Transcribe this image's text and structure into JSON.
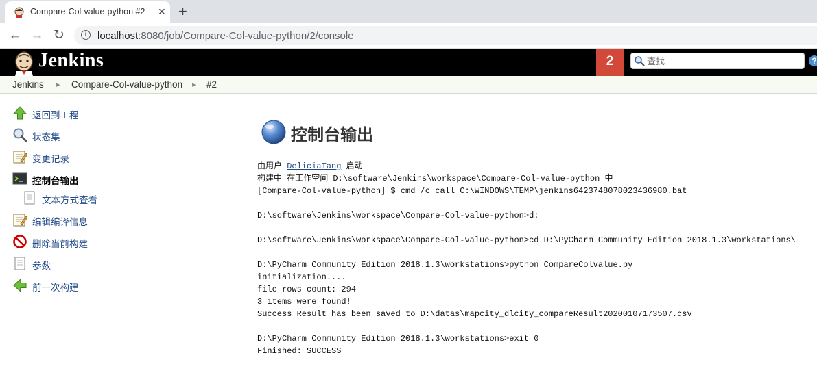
{
  "browser": {
    "tab_title": "Compare-Col-value-python #2",
    "close_glyph": "✕",
    "new_tab_glyph": "+",
    "back_glyph": "←",
    "forward_glyph": "→",
    "reload_glyph": "↻",
    "url_host": "localhost",
    "url_rest": ":8080/job/Compare-Col-value-python/2/console"
  },
  "header": {
    "title": "Jenkins",
    "badge": "2",
    "search_placeholder": "查找",
    "help": "?"
  },
  "breadcrumb": [
    "Jenkins",
    "Compare-Col-value-python",
    "#2"
  ],
  "breadcrumb_sep": "▸",
  "sidebar": {
    "items": [
      {
        "label": "返回到工程",
        "icon": "up-arrow-icon"
      },
      {
        "label": "状态集",
        "icon": "magnifier-icon"
      },
      {
        "label": "变更记录",
        "icon": "notepad-icon"
      },
      {
        "label": "控制台输出",
        "icon": "terminal-icon"
      },
      {
        "label": "文本方式查看",
        "icon": "document-icon"
      },
      {
        "label": "编辑编译信息",
        "icon": "notepad-icon"
      },
      {
        "label": "删除当前构建",
        "icon": "no-entry-icon"
      },
      {
        "label": "参数",
        "icon": "document-icon"
      },
      {
        "label": "前一次构建",
        "icon": "left-arrow-icon"
      }
    ]
  },
  "main": {
    "title": "控制台输出",
    "started_prefix": "由用户 ",
    "user": "DeliciaTang",
    "started_suffix": " 启动",
    "console_lines": "构建中 在工作空间 D:\\software\\Jenkins\\workspace\\Compare-Col-value-python 中\n[Compare-Col-value-python] $ cmd /c call C:\\WINDOWS\\TEMP\\jenkins6423748078023436980.bat\n\nD:\\software\\Jenkins\\workspace\\Compare-Col-value-python>d:\n\nD:\\software\\Jenkins\\workspace\\Compare-Col-value-python>cd D:\\PyCharm Community Edition 2018.1.3\\workstations\\\n\nD:\\PyCharm Community Edition 2018.1.3\\workstations>python CompareColvalue.py\ninitialization....\nfile rows count: 294\n3 items were found!\nSuccess Result has been saved to D:\\datas\\mapcity_dlcity_compareResult20200107173507.csv\n\nD:\\PyCharm Community Edition 2018.1.3\\workstations>exit 0\nFinished: SUCCESS"
  },
  "colors": {
    "header_bg": "#000000",
    "badge_bg": "#d24939",
    "link": "#204a87",
    "breadcrumb_bg": "#f6faf2"
  }
}
